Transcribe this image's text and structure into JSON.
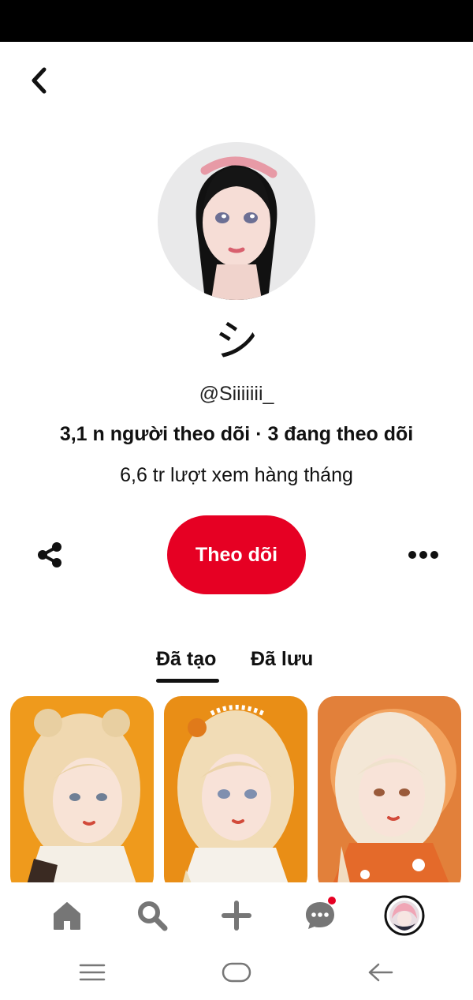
{
  "icons": {
    "back": "chevron-left-icon",
    "share": "share-icon",
    "more": "more-horizontal-icon",
    "home": "home-icon",
    "search": "search-icon",
    "create": "plus-icon",
    "messages": "chat-bubble-icon",
    "recent_apps": "menu-lines-icon",
    "system_home": "rounded-rect-icon",
    "system_back": "arrow-left-icon"
  },
  "colors": {
    "brand_red": "#e60023",
    "text": "#111111",
    "icon_gray": "#767676",
    "background": "#ffffff"
  },
  "profile": {
    "display_name": "シ",
    "username": "@Siiiiiii_",
    "stats": "3,1 n người theo dõi · 3 đang theo dõi",
    "monthly_views": "6,6 tr lượt xem hàng tháng"
  },
  "actions": {
    "follow_label": "Theo dõi"
  },
  "tabs": [
    {
      "label": "Đã tạo",
      "active": true
    },
    {
      "label": "Đã lưu",
      "active": false
    }
  ]
}
